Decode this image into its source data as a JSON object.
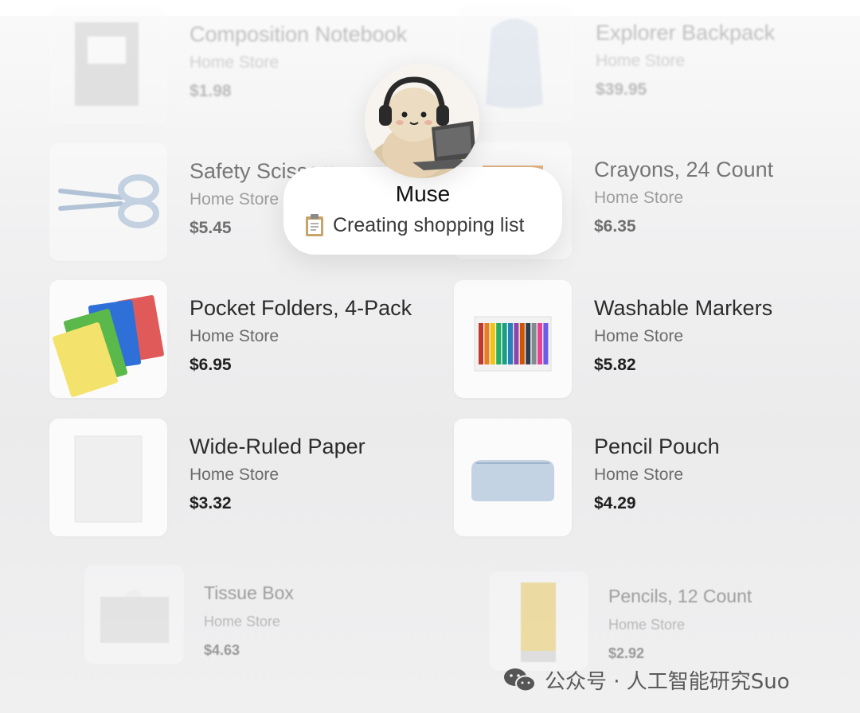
{
  "products": [
    {
      "name": "Composition Notebook",
      "store": "Home Store",
      "price": "$1.98"
    },
    {
      "name": "Explorer Backpack",
      "store": "Home Store",
      "price": "$39.95"
    },
    {
      "name": "Safety Scissors",
      "store": "Home Store",
      "price": "$5.45"
    },
    {
      "name": "Crayons, 24 Count",
      "store": "Home Store",
      "price": "$6.35"
    },
    {
      "name": "Pocket Folders, 4-Pack",
      "store": "Home Store",
      "price": "$6.95"
    },
    {
      "name": "Washable Markers",
      "store": "Home Store",
      "price": "$5.82"
    },
    {
      "name": "Wide-Ruled Paper",
      "store": "Home Store",
      "price": "$3.32"
    },
    {
      "name": "Pencil Pouch",
      "store": "Home Store",
      "price": "$4.29"
    },
    {
      "name": "Tissue Box",
      "store": "Home Store",
      "price": "$4.63"
    },
    {
      "name": "Pencils, 12 Count",
      "store": "Home Store",
      "price": "$2.92"
    }
  ],
  "agent": {
    "name": "Muse",
    "status": "Creating shopping list",
    "status_icon": "clipboard-icon",
    "avatar_icon": "plush-with-headphones-avatar"
  },
  "watermark": {
    "icon": "wechat-icon",
    "text": "公众号 · 人工智能研究Suo"
  }
}
